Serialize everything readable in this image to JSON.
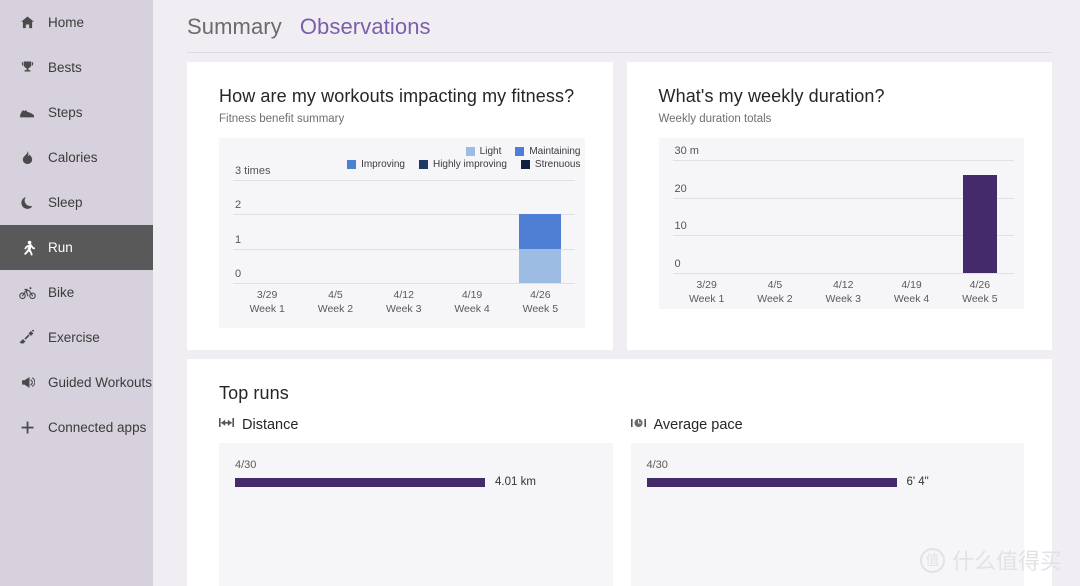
{
  "sidebar": {
    "items": [
      {
        "label": "Home",
        "icon": "home-icon",
        "active": false
      },
      {
        "label": "Bests",
        "icon": "trophy-icon",
        "active": false
      },
      {
        "label": "Steps",
        "icon": "shoe-icon",
        "active": false
      },
      {
        "label": "Calories",
        "icon": "flame-icon",
        "active": false
      },
      {
        "label": "Sleep",
        "icon": "moon-icon",
        "active": false
      },
      {
        "label": "Run",
        "icon": "running-icon",
        "active": true
      },
      {
        "label": "Bike",
        "icon": "bike-icon",
        "active": false
      },
      {
        "label": "Exercise",
        "icon": "dumbbell-icon",
        "active": false
      },
      {
        "label": "Guided Workouts",
        "icon": "megaphone-icon",
        "active": false
      },
      {
        "label": "Connected apps",
        "icon": "plus-icon",
        "active": false
      }
    ]
  },
  "tabs": [
    {
      "label": "Summary",
      "active": false
    },
    {
      "label": "Observations",
      "active": true
    }
  ],
  "colors": {
    "accent_purple": "#7b5fab",
    "bar_purple": "#442a6b",
    "light_blue": "#9cbce4",
    "medium_blue": "#4f7fd4",
    "dark_blue": "#1f3864",
    "darkest_blue": "#10203f",
    "sidebar_bg": "#d6d1dc",
    "selected_bg": "#595959",
    "page_bg": "#f0eef2",
    "panel_bg": "#f6f5f7"
  },
  "cards": {
    "fitness": {
      "title": "How are my workouts impacting my fitness?",
      "subtitle": "Fitness benefit summary"
    },
    "duration": {
      "title": "What's my weekly duration?",
      "subtitle": "Weekly duration totals"
    },
    "top_runs": {
      "title": "Top runs",
      "distance": {
        "label": "Distance",
        "icon": "distance-measure-icon",
        "date": "4/30",
        "value": "4.01 km"
      },
      "pace": {
        "label": "Average pace",
        "icon": "stopwatch-icon",
        "date": "4/30",
        "value": "6' 4\""
      }
    }
  },
  "chart_data": [
    {
      "type": "bar",
      "title": "How are my workouts impacting my fitness?",
      "subtitle": "Fitness benefit summary",
      "stacked": true,
      "xlabel": "",
      "ylabel": "times",
      "ylim": [
        0,
        3
      ],
      "yticks": [
        "0",
        "1",
        "2",
        "3 times"
      ],
      "ytick_values": [
        0,
        1,
        2,
        3
      ],
      "grid": true,
      "legend_position": "top-right",
      "legend": [
        {
          "name": "Light",
          "color": "#9cbce4"
        },
        {
          "name": "Maintaining",
          "color": "#4f7fd4"
        },
        {
          "name": "Improving",
          "color": "#4f7fd4"
        },
        {
          "name": "Highly improving",
          "color": "#1f3864"
        },
        {
          "name": "Strenuous",
          "color": "#10203f"
        }
      ],
      "categories": [
        "3/29\nWeek 1",
        "4/5\nWeek 2",
        "4/12\nWeek 3",
        "4/19\nWeek 4",
        "4/26\nWeek 5"
      ],
      "category_dates": [
        "3/29",
        "4/5",
        "4/12",
        "4/19",
        "4/26"
      ],
      "category_weeks": [
        "Week 1",
        "Week 2",
        "Week 3",
        "Week 4",
        "Week 5"
      ],
      "series": [
        {
          "name": "Light",
          "color": "#9cbce4",
          "values": [
            0,
            0,
            0,
            0,
            1
          ]
        },
        {
          "name": "Improving",
          "color": "#4f7fd4",
          "values": [
            0,
            0,
            0,
            0,
            1
          ]
        }
      ]
    },
    {
      "type": "bar",
      "title": "What's my weekly duration?",
      "subtitle": "Weekly duration totals",
      "stacked": false,
      "xlabel": "",
      "ylabel": "minutes",
      "ylim": [
        0,
        30
      ],
      "yticks": [
        "0",
        "10",
        "20",
        "30 m"
      ],
      "ytick_values": [
        0,
        10,
        20,
        30
      ],
      "grid": true,
      "categories": [
        "3/29\nWeek 1",
        "4/5\nWeek 2",
        "4/12\nWeek 3",
        "4/19\nWeek 4",
        "4/26\nWeek 5"
      ],
      "category_dates": [
        "3/29",
        "4/5",
        "4/12",
        "4/19",
        "4/26"
      ],
      "category_weeks": [
        "Week 1",
        "Week 2",
        "Week 3",
        "Week 4",
        "Week 5"
      ],
      "series": [
        {
          "name": "Weekly duration",
          "color": "#442a6b",
          "values": [
            0,
            0,
            0,
            0,
            26
          ]
        }
      ]
    },
    {
      "type": "bar",
      "orientation": "horizontal",
      "title": "Distance",
      "categories": [
        "4/30"
      ],
      "values": [
        4.01
      ],
      "value_labels": [
        "4.01 km"
      ],
      "unit": "km"
    },
    {
      "type": "bar",
      "orientation": "horizontal",
      "title": "Average pace",
      "categories": [
        "4/30"
      ],
      "values": [
        6.067
      ],
      "value_labels": [
        "6' 4\""
      ],
      "unit": "min/km"
    }
  ],
  "watermark": {
    "mark": "值",
    "text": "什么值得买"
  }
}
